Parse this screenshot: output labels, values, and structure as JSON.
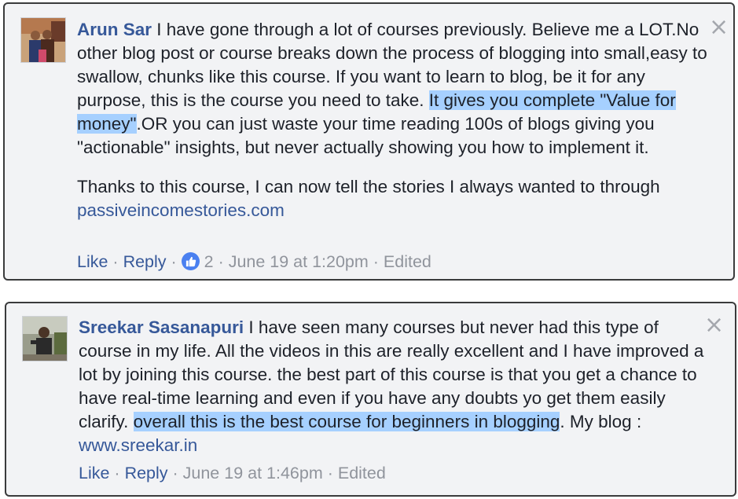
{
  "comments": [
    {
      "author": "Arun Sar",
      "text_1": " I have gone through a lot of courses previously. Believe me a LOT.No other blog post or course breaks down the process of blogging into small,easy to swallow, chunks like this course. If you want to learn to blog, be it for any purpose, this is the course you need to take. ",
      "highlight": "It gives you complete \"Value for money\"",
      "text_2": ".OR you can just waste your time reading 100s of blogs giving you \"actionable\" insights, but never actually showing you how to implement it.",
      "para2_text": "Thanks to this course, I can now tell the stories I always wanted to through ",
      "link": "passiveincomestories.com",
      "like_label": "Like",
      "sep1": " · ",
      "reply_label": "Reply",
      "sep2": " · ",
      "like_count": "2",
      "sep3": " · ",
      "timestamp": "June 19 at 1:20pm",
      "sep4": " · ",
      "edited": "Edited",
      "close_glyph": "×"
    },
    {
      "author": "Sreekar Sasanapuri",
      "text_1": " I have seen many courses but never had this type of course in my life. All the videos in this are really excellent and I have improved a lot by joining this course. the best part of this course is that you get a chance to have real-time learning and even if you have any doubts yo get them easily clarify. ",
      "highlight": "overall this is the best course for beginners in blogging",
      "text_2": ". My blog : ",
      "link": "www.sreekar.in",
      "like_label": "Like",
      "sep1": " · ",
      "reply_label": "Reply",
      "sep2": " · ",
      "timestamp": "June 19 at 1:46pm",
      "sep3": " · ",
      "edited": "Edited",
      "close_glyph": "×"
    }
  ],
  "colors": {
    "author": "#365899",
    "highlight": "#a6d0ff",
    "card_bg": "#f2f3f5",
    "meta": "#90949c",
    "like_badge": "#4a80f0"
  },
  "icons": {
    "like_badge": "thumbs-up-icon",
    "close": "close-icon"
  }
}
